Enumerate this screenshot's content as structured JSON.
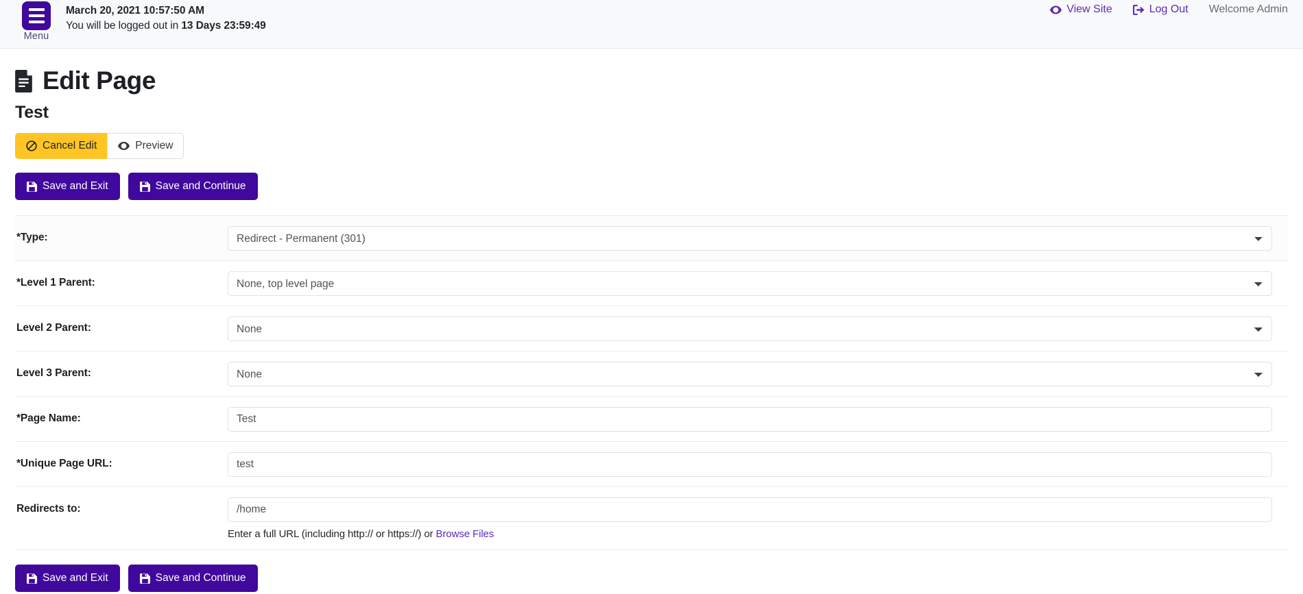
{
  "topbar": {
    "menu_label": "Menu",
    "session_datetime": "March 20, 2021 10:57:50 AM",
    "logout_prefix": "You will be logged out in ",
    "logout_countdown": "13 Days 23:59:49",
    "view_site_label": "View Site",
    "log_out_label": "Log Out",
    "welcome_label": "Welcome Admin",
    "accent_color": "#40089c",
    "link_color": "#5b2bb5",
    "background": "#f8f9fa",
    "icons": {
      "menu": "hamburger-icon",
      "view_site": "eye-icon",
      "log_out": "sign-out-icon"
    }
  },
  "header": {
    "title": "Edit Page",
    "subtitle": "Test",
    "title_icon": "document-icon"
  },
  "toolbar": {
    "cancel_label": "Cancel Edit",
    "cancel_icon": "ban-icon",
    "cancel_color": "#ffc524",
    "preview_label": "Preview",
    "preview_icon": "eye-icon"
  },
  "actions": {
    "save_exit_label": "Save and Exit",
    "save_continue_label": "Save and Continue",
    "save_icon": "floppy-disk-icon",
    "button_color": "#40089c"
  },
  "form": {
    "rows": [
      {
        "label": "*Type:",
        "kind": "select",
        "value": "Redirect - Permanent (301)",
        "options": [
          "Redirect - Permanent (301)"
        ]
      },
      {
        "label": "*Level 1 Parent:",
        "kind": "select",
        "value": "None, top level page",
        "options": [
          "None, top level page"
        ]
      },
      {
        "label": "Level 2 Parent:",
        "kind": "select",
        "value": "None",
        "options": [
          "None"
        ]
      },
      {
        "label": "Level 3 Parent:",
        "kind": "select",
        "value": "None",
        "options": [
          "None"
        ]
      },
      {
        "label": "*Page Name:",
        "kind": "text",
        "value": "Test"
      },
      {
        "label": "*Unique Page URL:",
        "kind": "text",
        "value": "test"
      },
      {
        "label": "Redirects to:",
        "kind": "text",
        "value": "/home",
        "help_before": "Enter a full URL (including http:// or https://) or ",
        "help_link": "Browse Files"
      }
    ]
  }
}
